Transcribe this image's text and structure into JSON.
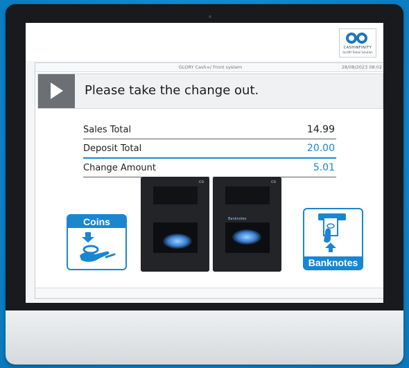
{
  "logo": {
    "brand": "CASHINFINITY",
    "tagline": "GLORY Retail Solution"
  },
  "titlebar": {
    "title": "GLORY Cash∞/ Front system",
    "datetime": "28/08/2023  08:02"
  },
  "message": {
    "text": "Please take the change out.",
    "icon": "play-icon"
  },
  "totals": [
    {
      "label": "Sales Total",
      "value": "14.99"
    },
    {
      "label": "Deposit Total",
      "value": "20.00"
    },
    {
      "label": "Change Amount",
      "value": "5.01"
    }
  ],
  "guide": {
    "coins_label": "Coins",
    "banknotes_label": "Banknotes",
    "machine_logo": "co",
    "machine_banknotes_tag": "Banknotes"
  },
  "colors": {
    "accent": "#1a86d0",
    "background": "#0e8fd6"
  }
}
